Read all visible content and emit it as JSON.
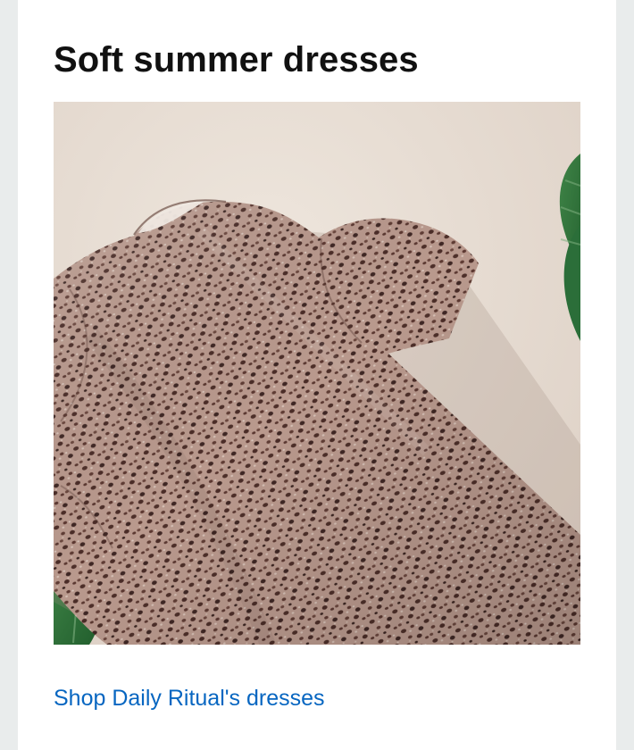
{
  "card": {
    "title": "Soft summer dresses",
    "image": {
      "subject": "leopard-print puff-sleeve dress with monstera leaves",
      "icon": "product-image"
    },
    "link_text": "Shop Daily Ritual's dresses"
  },
  "colors": {
    "page_background": "#e9ecec",
    "card_background": "#ffffff",
    "title": "#111111",
    "link": "#0766c1",
    "photo_background": "#e7ddd4",
    "dress_base": "#b9998d",
    "leaf": "#2c6f3b"
  }
}
